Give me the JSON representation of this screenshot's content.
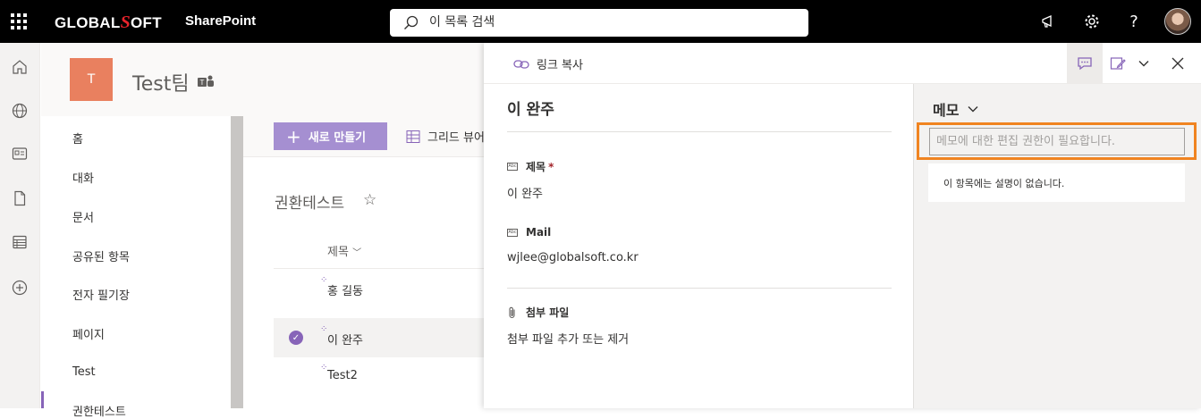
{
  "topbar": {
    "brand_prefix": "GLOBAL",
    "brand_s": "S",
    "brand_suffix": "OFT",
    "app_name": "SharePoint",
    "search_placeholder": "이 목록 검색"
  },
  "site": {
    "logo_letter": "T",
    "title": "Test팀"
  },
  "nav": {
    "items": [
      "홈",
      "대화",
      "문서",
      "공유된 항목",
      "전자 필기장",
      "페이지",
      "Test",
      "권한테스트"
    ]
  },
  "commandbar": {
    "new_label": "새로 만들기",
    "grid_view_label": "그리드 뷰어"
  },
  "list": {
    "title": "권환테스트",
    "column_title": "제목",
    "rows": [
      "홍 길동",
      "이 완주",
      "Test2"
    ]
  },
  "panel": {
    "copy_link_label": "링크 복사",
    "item_title": "이 완주",
    "fields": [
      {
        "label": "제목",
        "required_mark": "*",
        "value": "이 완주"
      },
      {
        "label": "Mail",
        "value": "wjlee@globalsoft.co.kr"
      }
    ],
    "attachments_label": "첨부 파일",
    "attachments_action": "첨부 파일 추가 또는 제거"
  },
  "memo": {
    "title": "메모",
    "input_placeholder": "메모에 대한 편집 권한이 필요합니다.",
    "description": "이 항목에는 설명이 없습니다."
  },
  "colors": {
    "accent": "#8764b8",
    "highlight": "#f08421",
    "site_logo": "#e9805f"
  }
}
